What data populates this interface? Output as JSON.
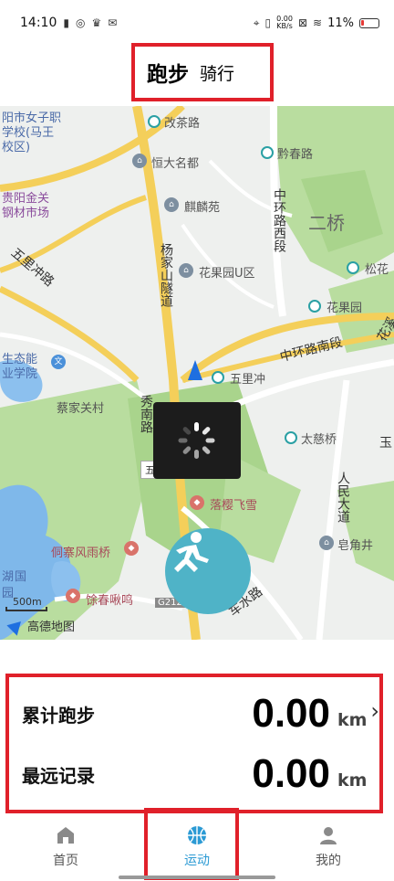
{
  "status_bar": {
    "time": "14:10",
    "net_speed_top": "0.00",
    "net_speed_bottom": "KB/s",
    "battery": "11%"
  },
  "tabs": {
    "run": "跑步",
    "ride": "骑行"
  },
  "map": {
    "labels": {
      "gaicha": "改茶路",
      "hengda": "恒大名都",
      "qianchun": "黔春路",
      "qilin": "麒麟苑",
      "huaguoyuan_u": "花果园U区",
      "erqiao": "二桥",
      "songhua": "松花",
      "huaguoyuan": "花果园",
      "zhonghuan_west": "中环路西段",
      "zhonghuan_south": "中环路南段",
      "wulichong": "五里冲",
      "wulichong_lijiao": "五里冲立交",
      "caijiaguan": "蔡家关村",
      "taiciqiao": "太慈桥",
      "luoyingfeixue": "落樱飞雪",
      "dongzhai": "侗寨风雨桥",
      "yuchun": "馀春啾鸣",
      "g212": "G212",
      "chesuilu": "车水路",
      "fujiaojing": "皂角井",
      "renmin": "人民大道",
      "yangjia": "杨家山隧道",
      "wuli_chong_lu": "五里冲路",
      "school1": "阳市女子职",
      "school2": "学校(马王",
      "school3": "校区)",
      "guiyang1": "贵阳金关",
      "guiyang2": "钢材市场",
      "eco1": "生态能",
      "eco2": "业学院",
      "huaxi": "花溪",
      "xiu": "秀南路",
      "hu1": "湖",
      "hu2": "国",
      "hu3": "园",
      "yu": "玉"
    },
    "scale": "500m",
    "logo": "高德地图"
  },
  "stats": {
    "total_label": "累计跑步",
    "total_value": "0.00",
    "total_unit": "km",
    "best_label": "最远记录",
    "best_value": "0.00",
    "best_unit": "km"
  },
  "nav": {
    "home": "首页",
    "sport": "运动",
    "mine": "我的"
  },
  "colors": {
    "accent": "#2b9ad4",
    "run_button": "#4fb3c7",
    "highlight_border": "#e0202a"
  }
}
